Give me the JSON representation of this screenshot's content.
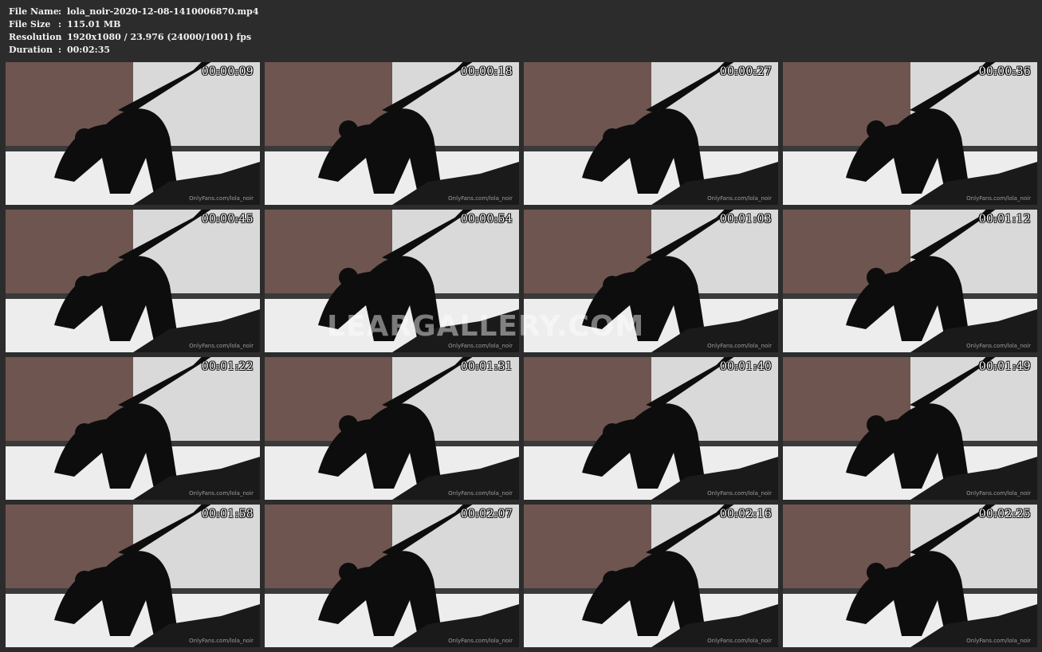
{
  "info": {
    "rows": [
      {
        "key": "File Name",
        "sep": ":",
        "value": "lola_noir-2020-12-08-1410006870.mp4"
      },
      {
        "key": "File Size",
        "sep": ":",
        "value": "115.01 MB"
      },
      {
        "key": "Resolution",
        "sep": ":",
        "value": "1920x1080 / 23.976 (24000/1001) fps"
      },
      {
        "key": "Duration",
        "sep": ":",
        "value": "00:02:35"
      }
    ]
  },
  "thumbnail_watermark": "OnlyFans.com/lola_noir",
  "overlay_watermark": "LEARGALLERY.COM",
  "thumbnails": [
    {
      "timestamp": "00:00:09"
    },
    {
      "timestamp": "00:00:18"
    },
    {
      "timestamp": "00:00:27"
    },
    {
      "timestamp": "00:00:36"
    },
    {
      "timestamp": "00:00:45"
    },
    {
      "timestamp": "00:00:54"
    },
    {
      "timestamp": "00:01:03"
    },
    {
      "timestamp": "00:01:12"
    },
    {
      "timestamp": "00:01:22"
    },
    {
      "timestamp": "00:01:31"
    },
    {
      "timestamp": "00:01:40"
    },
    {
      "timestamp": "00:01:49"
    },
    {
      "timestamp": "00:01:58"
    },
    {
      "timestamp": "00:02:07"
    },
    {
      "timestamp": "00:02:16"
    },
    {
      "timestamp": "00:02:25"
    }
  ],
  "colors": {
    "background": "#2c2c2c",
    "text": "#f2f2f2",
    "curtain": "#6e5550",
    "wall": "#d9d9d9",
    "bed": "#ededed",
    "figure": "#0d0d0d"
  }
}
